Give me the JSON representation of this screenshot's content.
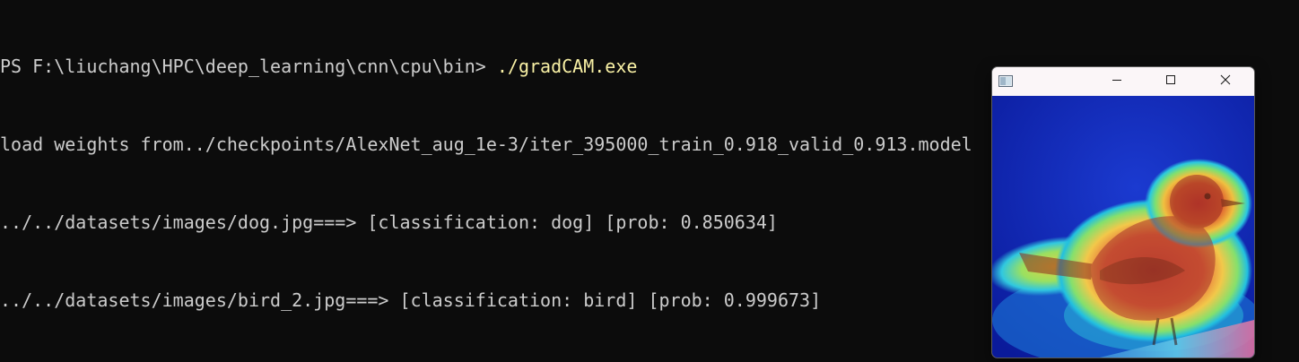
{
  "terminal": {
    "prompt": "PS F:\\liuchang\\HPC\\deep_learning\\cnn\\cpu\\bin> ",
    "command": "./gradCAM.exe",
    "output": [
      "load weights from../checkpoints/AlexNet_aug_1e-3/iter_395000_train_0.918_valid_0.913.model",
      "../../datasets/images/dog.jpg===> [classification: dog] [prob: 0.850634]",
      "../../datasets/images/bird_2.jpg===> [classification: bird] [prob: 0.999673]"
    ],
    "prompt_color": "#cccccc",
    "command_color": "#f9f1a5",
    "background": "#0c0c0c"
  },
  "viewer_window": {
    "icons": {
      "app": "image-viewer-app-icon",
      "minimize": "minimize-icon",
      "maximize": "maximize-icon",
      "close": "close-icon"
    },
    "image": {
      "subject": "Grad-CAM heatmap overlay on bird photo",
      "palette": [
        "#0a1fa8",
        "#1f6fe0",
        "#27d0e0",
        "#8be06a",
        "#f5e04a",
        "#f08a3a",
        "#d43a2a"
      ]
    }
  }
}
